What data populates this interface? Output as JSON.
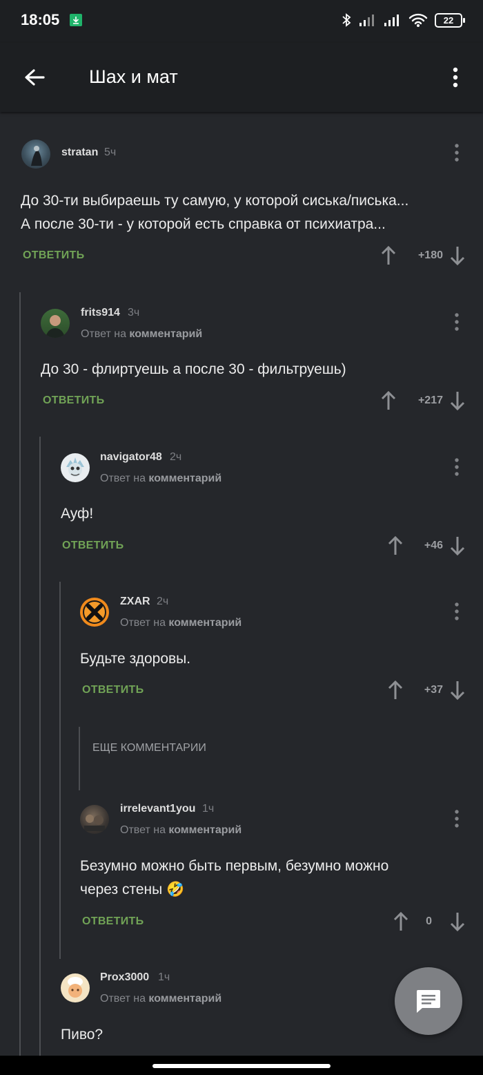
{
  "status_bar": {
    "time": "18:05",
    "battery": "22"
  },
  "header": {
    "title": "Шах и мат"
  },
  "reply_label": "ОТВЕТИТЬ",
  "reply_to": {
    "prefix": "Ответ на",
    "target": "комментарий"
  },
  "comments": [
    {
      "author": "stratan",
      "time": "5ч",
      "lines": [
        "До 30-ти выбираешь ту самую, у которой сиська/писька...",
        "А после 30-ти - у которой есть справка от психиатра..."
      ],
      "score": "+180"
    },
    {
      "author": "frits914",
      "time": "3ч",
      "lines": [
        "До 30 - флиртуешь а после 30 - фильтруешь)"
      ],
      "score": "+217"
    },
    {
      "author": "navigator48",
      "time": "2ч",
      "lines": [
        "Ауф!"
      ],
      "score": "+46"
    },
    {
      "author": "ZXAR",
      "time": "2ч",
      "lines": [
        "Будьте здоровы."
      ],
      "score": "+37"
    },
    {
      "author": "irrelevant1you",
      "time": "1ч",
      "lines": [
        "Безумно можно быть первым, безумно можно",
        "через стены 🤣"
      ],
      "score": "0"
    },
    {
      "author": "Prox3000",
      "time": "1ч",
      "lines": [
        "Пиво?"
      ],
      "score": ""
    }
  ],
  "more_comments_label": "ЕЩЕ КОММЕНТАРИИ",
  "colors": {
    "background": "#25272b",
    "accent_green": "#71a356",
    "fab": "#7e8084"
  }
}
